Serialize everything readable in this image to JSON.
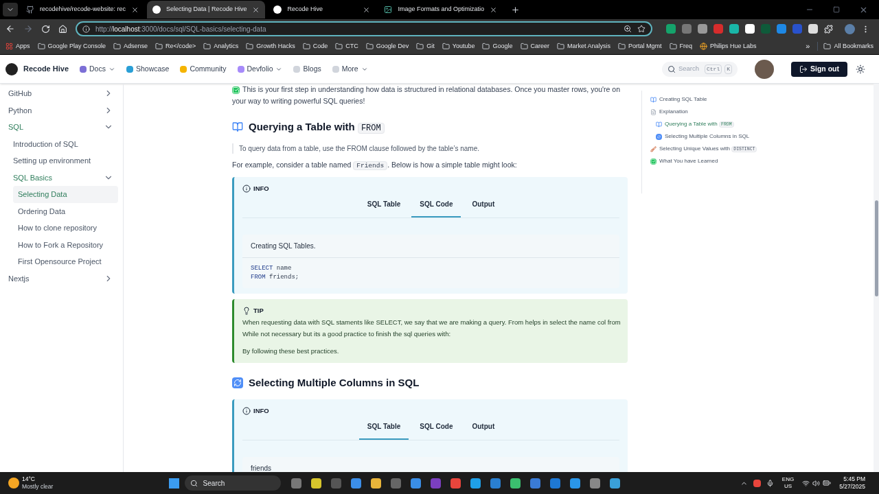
{
  "browser": {
    "tabs": [
      {
        "title": "recodehive/recode-website: rec",
        "selected": false,
        "kind": "github"
      },
      {
        "title": "Selecting Data | Recode Hive",
        "selected": true,
        "kind": "site"
      },
      {
        "title": "Recode Hive",
        "selected": false,
        "kind": "site"
      },
      {
        "title": "Image Formats and Optimizatio",
        "selected": false,
        "kind": "other"
      }
    ],
    "url_host": "localhost",
    "url_rest": ":3000/docs/sql/SQL-basics/selecting-data",
    "url_scheme": "http://",
    "bookmarks": [
      {
        "label": "Apps",
        "kind": "apps"
      },
      {
        "label": "Google Play Console",
        "kind": "folder"
      },
      {
        "label": "Adsense",
        "kind": "folder"
      },
      {
        "label": "Re</code>",
        "kind": "folder"
      },
      {
        "label": "Analytics",
        "kind": "folder"
      },
      {
        "label": "Growth Hacks",
        "kind": "folder"
      },
      {
        "label": "Code",
        "kind": "folder"
      },
      {
        "label": "CTC",
        "kind": "folder"
      },
      {
        "label": "Google Dev",
        "kind": "folder"
      },
      {
        "label": "Git",
        "kind": "folder"
      },
      {
        "label": "Youtube",
        "kind": "folder"
      },
      {
        "label": "Google",
        "kind": "folder"
      },
      {
        "label": "Career",
        "kind": "folder"
      },
      {
        "label": "Market Analysis",
        "kind": "folder"
      },
      {
        "label": "Portal Mgmt",
        "kind": "folder"
      },
      {
        "label": "Freq",
        "kind": "folder"
      },
      {
        "label": "Philips Hue Labs",
        "kind": "site"
      }
    ],
    "more": "»",
    "all_bookmarks": "All Bookmarks"
  },
  "navbar": {
    "brand": "Recode Hive",
    "items": [
      {
        "label": "Docs",
        "dropdown": true
      },
      {
        "label": "Showcase",
        "dropdown": false
      },
      {
        "label": "Community",
        "dropdown": false
      },
      {
        "label": "Devfolio",
        "dropdown": true
      },
      {
        "label": "Blogs",
        "dropdown": false
      },
      {
        "label": "More",
        "dropdown": true
      }
    ],
    "search": {
      "placeholder": "Search",
      "keys": [
        "Ctrl",
        "K"
      ]
    },
    "sign_out": "Sign out"
  },
  "sidebar": {
    "items": [
      {
        "label": "GitHub",
        "kind": "category",
        "expanded": false,
        "selected": false
      },
      {
        "label": "Python",
        "kind": "category",
        "expanded": false,
        "selected": false
      },
      {
        "label": "SQL",
        "kind": "category",
        "expanded": true,
        "selected": true,
        "children": [
          {
            "label": "Introduction of SQL",
            "kind": "link",
            "selected": false
          },
          {
            "label": "Setting up environment",
            "kind": "link",
            "selected": false
          },
          {
            "label": "SQL Basics",
            "kind": "category",
            "expanded": true,
            "selected": true,
            "children": [
              {
                "label": "Selecting Data",
                "kind": "link",
                "selected": true
              },
              {
                "label": "Ordering Data",
                "kind": "link",
                "selected": false
              },
              {
                "label": "How to clone repository",
                "kind": "link",
                "selected": false
              },
              {
                "label": "How to Fork a Repository",
                "kind": "link",
                "selected": false
              },
              {
                "label": "First Opensource Project",
                "kind": "link",
                "selected": false
              }
            ]
          }
        ]
      },
      {
        "label": "Nextjs",
        "kind": "category",
        "expanded": false,
        "selected": false
      }
    ]
  },
  "content": {
    "blocks": [
      {
        "kind": "paragraph",
        "parts": [
          {
            "text": "This is your first step in understanding how data is structured in relational databases. Once you master rows, you're on your way to writing powerful SQL queries!",
            "code": false
          }
        ]
      },
      {
        "kind": "heading",
        "parts": [
          {
            "text": "Querying a Table with ",
            "code": false
          },
          {
            "text": "FROM",
            "code": true
          }
        ]
      },
      {
        "kind": "quote",
        "parts": [
          {
            "text": "To query data from a table, use the FROM clause followed by the table’s name.",
            "code": false
          }
        ]
      },
      {
        "kind": "paragraph",
        "parts": [
          {
            "text": "For example, consider a table named ",
            "code": false
          },
          {
            "text": "Friends",
            "code": true
          },
          {
            "text": ". Below is how a simple table might look:",
            "code": false
          }
        ]
      },
      {
        "kind": "info",
        "title": "INFO",
        "tabs": [
          {
            "label": "SQL Table",
            "selected": false
          },
          {
            "label": "SQL Code",
            "selected": true
          },
          {
            "label": "Output",
            "selected": false
          }
        ],
        "caption": "Creating SQL Tables.",
        "code": [
          [
            {
              "text": "SELECT",
              "kind": "keyword"
            },
            {
              "text": " name",
              "kind": "plain"
            }
          ],
          [
            {
              "text": "FROM",
              "kind": "keyword"
            },
            {
              "text": " friends;",
              "kind": "plain"
            }
          ]
        ]
      },
      {
        "kind": "tip",
        "title": "TIP",
        "lines": [
          "When requesting data with SQL staments like SELECT, we say that we are making a query. From helps in select the name col from",
          "While not necessary but its a good practice to finish the sql queries with:",
          "By following these best practices."
        ]
      },
      {
        "kind": "heading",
        "parts": [
          {
            "text": "Selecting Multiple Columns in SQL",
            "code": false
          }
        ]
      },
      {
        "kind": "info",
        "title": "INFO",
        "tabs": [
          {
            "label": "SQL Table",
            "selected": true
          },
          {
            "label": "SQL Code",
            "selected": false
          },
          {
            "label": "Output",
            "selected": false
          }
        ],
        "caption": "friends"
      }
    ]
  },
  "toc": {
    "items": [
      {
        "label": "Creating SQL Table",
        "selected": false
      },
      {
        "label": "Explanation",
        "selected": false,
        "children": [
          {
            "label": "Querying a Table with ",
            "code": "FROM",
            "selected": true
          },
          {
            "label": "Selecting Multiple Columns in SQL",
            "selected": false
          }
        ]
      },
      {
        "label": "Selecting Unique Values with ",
        "code": "DISTINCT",
        "selected": false
      },
      {
        "label": "What You have Learned",
        "selected": false
      }
    ]
  },
  "taskbar": {
    "temperature": "14°C",
    "weather": "Mostly clear",
    "search": "Search",
    "language": "ENG",
    "region": "US",
    "time": "5:45 PM",
    "date": "5/27/2025"
  }
}
